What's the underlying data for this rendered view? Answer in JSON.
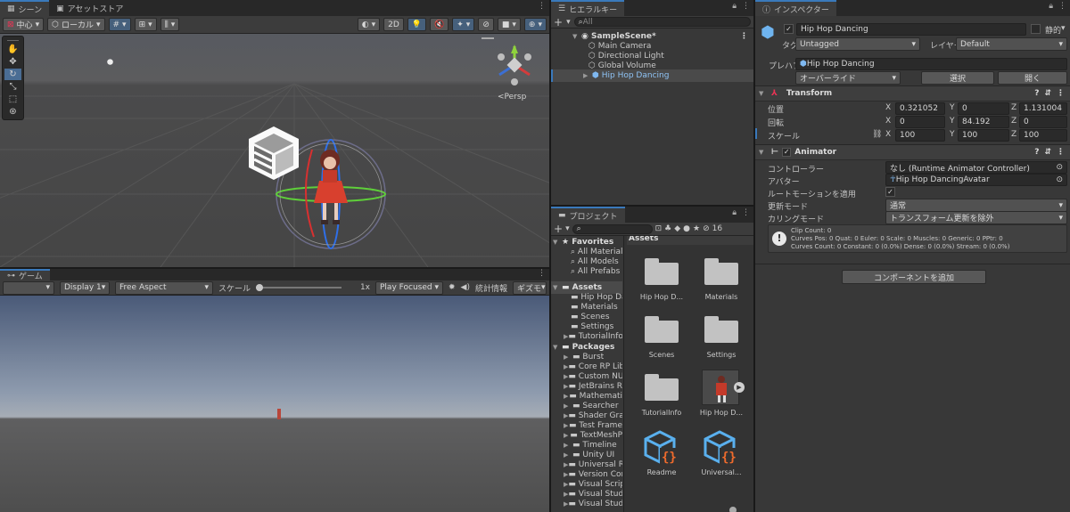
{
  "scene": {
    "tabs": [
      {
        "label": "シーン"
      },
      {
        "label": "アセットストア"
      }
    ],
    "toolbar": {
      "pivot": "中心",
      "space": "ローカル",
      "mode2d": "2D"
    },
    "persp": "<Persp"
  },
  "game": {
    "tab": "ゲーム",
    "display": "Display 1",
    "aspect": "Free Aspect",
    "scale_label": "スケール",
    "scale_value": "1x",
    "play_mode": "Play Focused",
    "stats": "統計情報",
    "gizmos": "ギズモ"
  },
  "hierarchy": {
    "tab": "ヒエラルキー",
    "search_placeholder": "All",
    "scene": "SampleScene*",
    "items": [
      {
        "label": "Main Camera"
      },
      {
        "label": "Directional Light"
      },
      {
        "label": "Global Volume"
      },
      {
        "label": "Hip Hop Dancing"
      }
    ]
  },
  "project": {
    "tab": "プロジェクト",
    "count": "16",
    "favorites_label": "Favorites",
    "favorites": [
      {
        "label": "All Material"
      },
      {
        "label": "All Models"
      },
      {
        "label": "All Prefabs"
      }
    ],
    "assets_label": "Assets",
    "assets": [
      {
        "label": "Hip Hop Da"
      },
      {
        "label": "Materials"
      },
      {
        "label": "Scenes"
      },
      {
        "label": "Settings"
      },
      {
        "label": "TutorialInfo"
      }
    ],
    "packages_label": "Packages",
    "packages": [
      {
        "label": "Burst"
      },
      {
        "label": "Core RP Lib"
      },
      {
        "label": "Custom NU"
      },
      {
        "label": "JetBrains R"
      },
      {
        "label": "Mathemati"
      },
      {
        "label": "Searcher"
      },
      {
        "label": "Shader Gra"
      },
      {
        "label": "Test Frame"
      },
      {
        "label": "TextMeshP"
      },
      {
        "label": "Timeline"
      },
      {
        "label": "Unity UI"
      },
      {
        "label": "Universal R"
      },
      {
        "label": "Version Cor"
      },
      {
        "label": "Visual Scrip"
      },
      {
        "label": "Visual Stud"
      },
      {
        "label": "Visual Stud"
      }
    ],
    "grid_title": "Assets",
    "grid": [
      {
        "label": "Hip Hop D..."
      },
      {
        "label": "Materials"
      },
      {
        "label": "Scenes"
      },
      {
        "label": "Settings"
      },
      {
        "label": "TutorialInfo"
      },
      {
        "label": "Hip Hop D..."
      },
      {
        "label": "Readme"
      },
      {
        "label": "Universal..."
      }
    ]
  },
  "inspector": {
    "tab": "インスペクター",
    "name": "Hip Hop Dancing",
    "static": "静的",
    "tag_label": "タグ",
    "tag": "Untagged",
    "layer_label": "レイヤー",
    "layer": "Default",
    "prefab_label": "プレハブ",
    "prefab": "Hip Hop Dancing",
    "override": "オーバーライド",
    "select": "選択",
    "open": "開く",
    "transform": {
      "title": "Transform",
      "position_label": "位置",
      "rotation_label": "回転",
      "scale_label": "スケール",
      "position": {
        "x": "0.321052",
        "y": "0",
        "z": "1.131004"
      },
      "rotation": {
        "x": "0",
        "y": "84.192",
        "z": "0"
      },
      "scale": {
        "x": "100",
        "y": "100",
        "z": "100"
      }
    },
    "animator": {
      "title": "Animator",
      "controller_label": "コントローラー",
      "controller": "なし (Runtime Animator Controller)",
      "avatar_label": "アバター",
      "avatar": "Hip Hop DancingAvatar",
      "root_motion_label": "ルートモーションを適用",
      "update_label": "更新モード",
      "update": "通常",
      "culling_label": "カリングモード",
      "culling": "トランスフォーム更新を除外",
      "info1": "Clip Count: 0",
      "info2": "Curves Pos: 0 Quat: 0 Euler: 0 Scale: 0 Muscles: 0 Generic: 0 PPtr: 0",
      "info3": "Curves Count: 0 Constant: 0 (0.0%) Dense: 0 (0.0%) Stream: 0 (0.0%)"
    },
    "add_component": "コンポーネントを追加"
  }
}
